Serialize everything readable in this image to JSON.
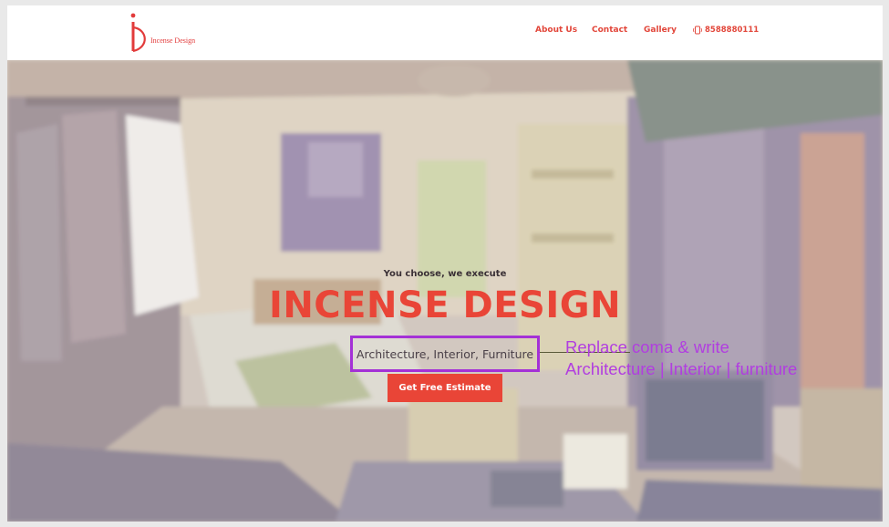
{
  "header": {
    "logo_text": "Incense Design",
    "nav": [
      {
        "label": "About Us"
      },
      {
        "label": "Contact"
      },
      {
        "label": "Gallery"
      }
    ],
    "phone": "8588880111",
    "phone_icon": "phone-icon"
  },
  "hero": {
    "tagline": "You choose, we execute",
    "title": "INCENSE DESIGN",
    "subtitle": "Architecture, Interior, Furniture",
    "cta_label": "Get Free Estimate",
    "background": "illustrated-room-image"
  },
  "annotation": {
    "line1": "Replace coma & write",
    "line2": "Architecture | Interior | furniture",
    "color": "#b13ee0"
  },
  "colors": {
    "brand": "#e94537",
    "annotation_box": "#a431d6"
  }
}
